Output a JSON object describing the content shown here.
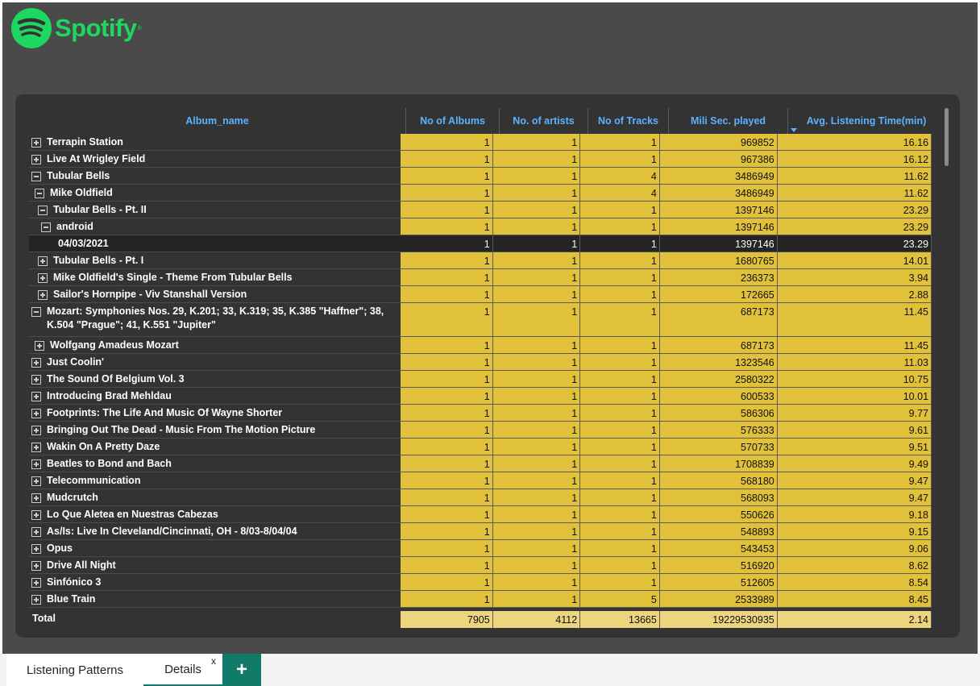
{
  "app": {
    "logo_text": "Spotify",
    "logo_tm": "®",
    "accent_color": "#1ed760",
    "cell_color": "#e2c13a",
    "tab_accent": "#127a69"
  },
  "matrix": {
    "columns": [
      {
        "label": "Album_name"
      },
      {
        "label": "No of Albums"
      },
      {
        "label": "No. of artists"
      },
      {
        "label": "No of Tracks"
      },
      {
        "label": "Mili Sec. played"
      },
      {
        "label": "Avg. Listening Time(min)"
      }
    ],
    "sort_column": "Avg. Listening Time(min)",
    "sort_direction": "descending",
    "rows": [
      {
        "label": "Terrapin Station",
        "toggle": "expand",
        "albums": "1",
        "artists": "1",
        "tracks": "1",
        "ms": "969852",
        "avg": "16.16"
      },
      {
        "label": "Live At Wrigley Field",
        "toggle": "expand",
        "albums": "1",
        "artists": "1",
        "tracks": "1",
        "ms": "967386",
        "avg": "16.12"
      },
      {
        "label": "Tubular Bells",
        "toggle": "collapse",
        "albums": "1",
        "artists": "1",
        "tracks": "4",
        "ms": "3486949",
        "avg": "11.62"
      },
      {
        "label": "Mike Oldfield",
        "toggle": "collapse",
        "albums": "1",
        "artists": "1",
        "tracks": "4",
        "ms": "3486949",
        "avg": "11.62"
      },
      {
        "label": "Tubular Bells - Pt. II",
        "toggle": "collapse",
        "albums": "1",
        "artists": "1",
        "tracks": "1",
        "ms": "1397146",
        "avg": "23.29"
      },
      {
        "label": "android",
        "toggle": "collapse",
        "albums": "1",
        "artists": "1",
        "tracks": "1",
        "ms": "1397146",
        "avg": "23.29"
      },
      {
        "label": "04/03/2021",
        "toggle": "none",
        "albums": "1",
        "artists": "1",
        "tracks": "1",
        "ms": "1397146",
        "avg": "23.29"
      },
      {
        "label": "Tubular Bells - Pt. I",
        "toggle": "expand",
        "albums": "1",
        "artists": "1",
        "tracks": "1",
        "ms": "1680765",
        "avg": "14.01"
      },
      {
        "label": "Mike Oldfield's Single - Theme From Tubular Bells",
        "toggle": "expand",
        "albums": "1",
        "artists": "1",
        "tracks": "1",
        "ms": "236373",
        "avg": "3.94"
      },
      {
        "label": "Sailor's Hornpipe - Viv Stanshall Version",
        "toggle": "expand",
        "albums": "1",
        "artists": "1",
        "tracks": "1",
        "ms": "172665",
        "avg": "2.88"
      },
      {
        "label": "Mozart: Symphonies Nos. 29, K.201; 33, K.319; 35, K.385 \"Haffner\"; 38, K.504 \"Prague\"; 41, K.551 \"Jupiter\"",
        "toggle": "collapse",
        "albums": "1",
        "artists": "1",
        "tracks": "1",
        "ms": "687173",
        "avg": "11.45"
      },
      {
        "label": "Wolfgang Amadeus Mozart",
        "toggle": "expand",
        "albums": "1",
        "artists": "1",
        "tracks": "1",
        "ms": "687173",
        "avg": "11.45"
      },
      {
        "label": "Just Coolin'",
        "toggle": "expand",
        "albums": "1",
        "artists": "1",
        "tracks": "1",
        "ms": "1323546",
        "avg": "11.03"
      },
      {
        "label": "The Sound Of Belgium Vol. 3",
        "toggle": "expand",
        "albums": "1",
        "artists": "1",
        "tracks": "1",
        "ms": "2580322",
        "avg": "10.75"
      },
      {
        "label": "Introducing Brad Mehldau",
        "toggle": "expand",
        "albums": "1",
        "artists": "1",
        "tracks": "1",
        "ms": "600533",
        "avg": "10.01"
      },
      {
        "label": "Footprints: The Life And Music Of Wayne Shorter",
        "toggle": "expand",
        "albums": "1",
        "artists": "1",
        "tracks": "1",
        "ms": "586306",
        "avg": "9.77"
      },
      {
        "label": "Bringing Out The Dead - Music From The Motion Picture",
        "toggle": "expand",
        "albums": "1",
        "artists": "1",
        "tracks": "1",
        "ms": "576333",
        "avg": "9.61"
      },
      {
        "label": "Wakin On A Pretty Daze",
        "toggle": "expand",
        "albums": "1",
        "artists": "1",
        "tracks": "1",
        "ms": "570733",
        "avg": "9.51"
      },
      {
        "label": "Beatles to Bond and Bach",
        "toggle": "expand",
        "albums": "1",
        "artists": "1",
        "tracks": "1",
        "ms": "1708839",
        "avg": "9.49"
      },
      {
        "label": "Telecommunication",
        "toggle": "expand",
        "albums": "1",
        "artists": "1",
        "tracks": "1",
        "ms": "568180",
        "avg": "9.47"
      },
      {
        "label": "Mudcrutch",
        "toggle": "expand",
        "albums": "1",
        "artists": "1",
        "tracks": "1",
        "ms": "568093",
        "avg": "9.47"
      },
      {
        "label": "Lo Que Aletea en Nuestras Cabezas",
        "toggle": "expand",
        "albums": "1",
        "artists": "1",
        "tracks": "1",
        "ms": "550626",
        "avg": "9.18"
      },
      {
        "label": "As/Is: Live In Cleveland/Cincinnati, OH - 8/03-8/04/04",
        "toggle": "expand",
        "albums": "1",
        "artists": "1",
        "tracks": "1",
        "ms": "548893",
        "avg": "9.15"
      },
      {
        "label": "Opus",
        "toggle": "expand",
        "albums": "1",
        "artists": "1",
        "tracks": "1",
        "ms": "543453",
        "avg": "9.06"
      },
      {
        "label": "Drive All Night",
        "toggle": "expand",
        "albums": "1",
        "artists": "1",
        "tracks": "1",
        "ms": "516920",
        "avg": "8.62"
      },
      {
        "label": "Sinfónico 3",
        "toggle": "expand",
        "albums": "1",
        "artists": "1",
        "tracks": "1",
        "ms": "512605",
        "avg": "8.54"
      },
      {
        "label": "Blue Train",
        "toggle": "expand",
        "albums": "1",
        "artists": "1",
        "tracks": "5",
        "ms": "2533989",
        "avg": "8.45"
      }
    ],
    "total": {
      "label": "Total",
      "albums": "7905",
      "artists": "4112",
      "tracks": "13665",
      "ms": "19229530935",
      "avg": "2.14"
    }
  },
  "tabs": [
    {
      "label": "Listening Patterns",
      "active": false
    },
    {
      "label": "Details",
      "active": true,
      "close": "x"
    }
  ],
  "add_tab_label": "+"
}
